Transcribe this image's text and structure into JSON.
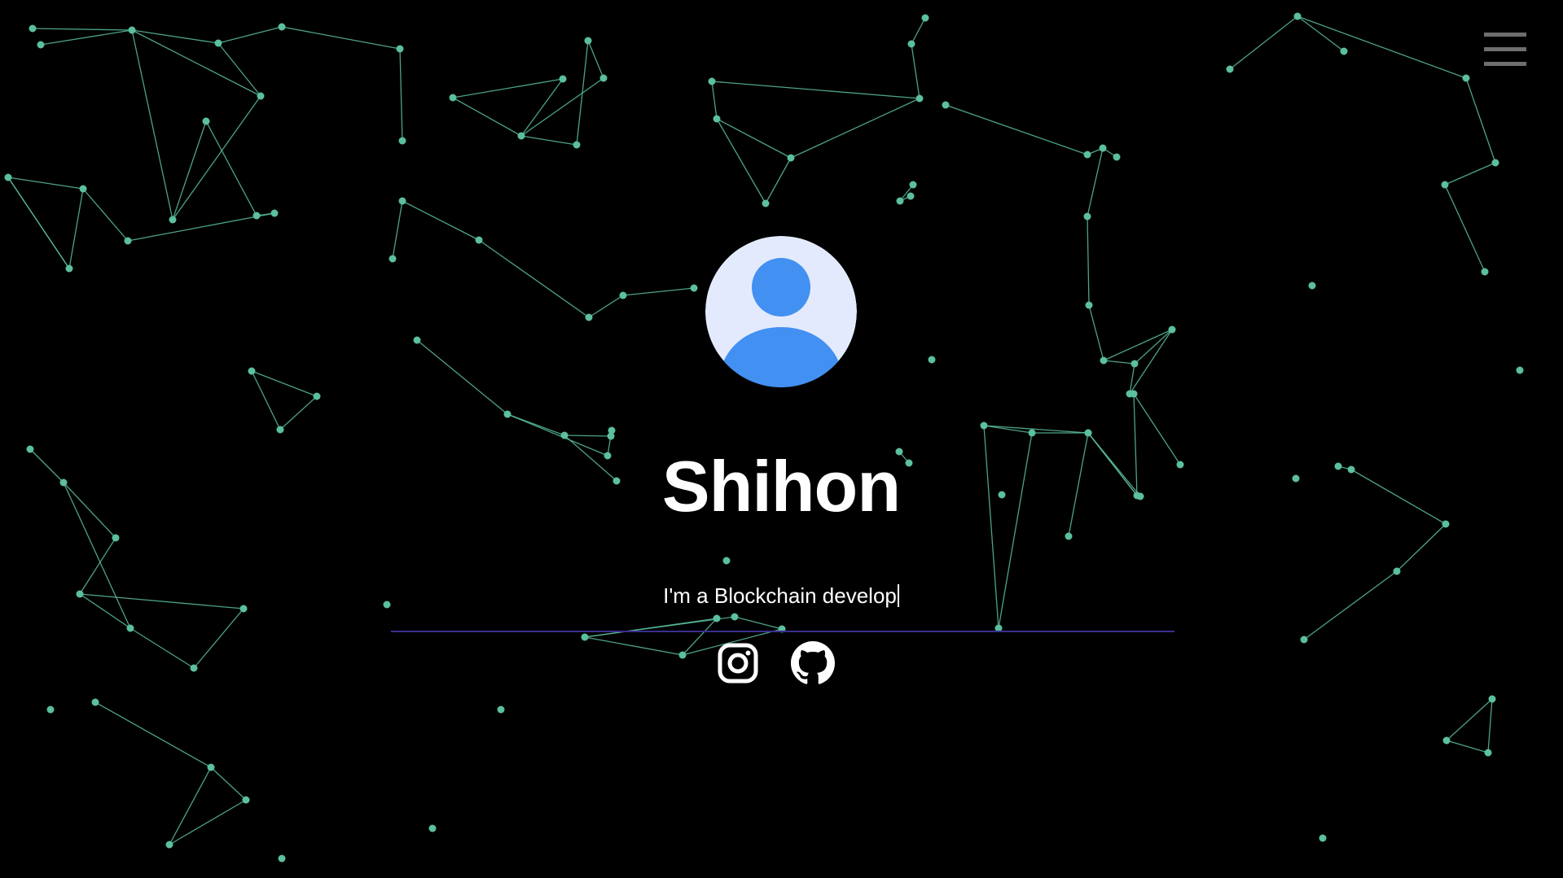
{
  "profile": {
    "name": "Shihon",
    "typed_text": "I'm a Blockchain develop"
  },
  "colors": {
    "background": "#000000",
    "particle": "#5bbfa0",
    "avatar_bg": "#e3eafd",
    "avatar_fg": "#4290f2",
    "divider": "#3a2f8f",
    "menu": "#6e6e6e",
    "text": "#ffffff"
  },
  "nav": {
    "menu_icon": "hamburger-menu-icon"
  },
  "social": [
    {
      "name": "Instagram",
      "icon": "instagram-icon"
    },
    {
      "name": "GitHub",
      "icon": "github-icon"
    }
  ]
}
